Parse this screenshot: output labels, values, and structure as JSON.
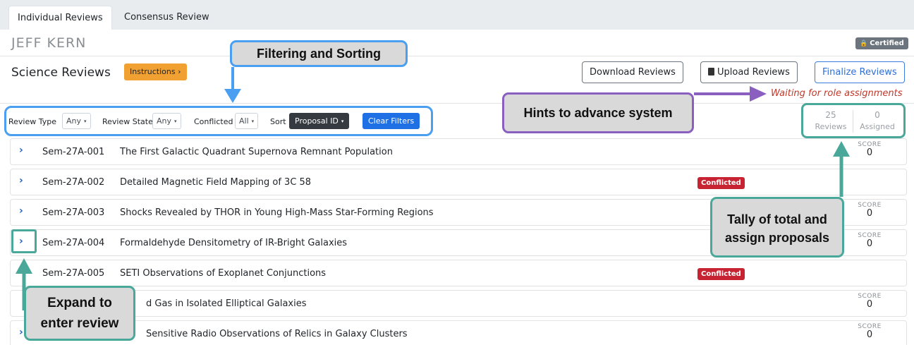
{
  "tabs": [
    {
      "label": "Individual Reviews",
      "active": true
    },
    {
      "label": "Consensus Review",
      "active": false
    }
  ],
  "reviewer": {
    "name": "JEFF KERN",
    "certified_label": "Certified"
  },
  "section": {
    "title": "Science Reviews",
    "instructions_label": "Instructions ›"
  },
  "actions": {
    "download_label": "Download Reviews",
    "upload_label": "Upload Reviews",
    "finalize_label": "Finalize Reviews"
  },
  "status_text": "Waiting for role assignments",
  "filters": {
    "review_type_label": "Review Type",
    "review_type_value": "Any",
    "review_state_label": "Review State",
    "review_state_value": "Any",
    "conflicted_label": "Conflicted",
    "conflicted_value": "All",
    "sort_label": "Sort",
    "sort_value": "Proposal ID",
    "clear_label": "Clear Filters",
    "caret": "▾"
  },
  "tally": {
    "reviews_count": "25",
    "reviews_label": "Reviews",
    "assigned_count": "0",
    "assigned_label": "Assigned"
  },
  "score_label": "SCORE",
  "conflicted_badge": "Conflicted",
  "expand_glyph": "›",
  "proposals": [
    {
      "id": "Sem-27A-001",
      "title": "The First Galactic Quadrant Supernova Remnant Population",
      "score": "0",
      "conflicted": false
    },
    {
      "id": "Sem-27A-002",
      "title": "Detailed Magnetic Field Mapping of 3C 58",
      "score": "",
      "conflicted": true
    },
    {
      "id": "Sem-27A-003",
      "title": "Shocks Revealed by THOR in Young High-Mass Star-Forming Regions",
      "score": "0",
      "conflicted": false
    },
    {
      "id": "Sem-27A-004",
      "title": "Formaldehyde Densitometry of IR-Bright Galaxies",
      "score": "0",
      "conflicted": false
    },
    {
      "id": "Sem-27A-005",
      "title": "SETI Observations of Exoplanet Conjunctions",
      "score": "",
      "conflicted": true
    },
    {
      "id": "",
      "title": "d Gas in Isolated Elliptical Galaxies",
      "score": "0",
      "conflicted": false
    },
    {
      "id": "",
      "title": "Sensitive Radio Observations of Relics in Galaxy Clusters",
      "score": "0",
      "conflicted": false
    }
  ],
  "annotations": {
    "filtering": "Filtering and Sorting",
    "hints": "Hints to advance system",
    "tally_line1": "Tally of total and",
    "tally_line2": "assign proposals",
    "expand_line1": "Expand to",
    "expand_line2": "enter review"
  },
  "colors": {
    "annotation_blue": "#4a9ff0",
    "annotation_purple": "#8a5fc0",
    "annotation_teal": "#4aa89a",
    "conflicted_red": "#c82333",
    "instructions_orange": "#f0a132",
    "clear_filters_blue": "#1f6fe5"
  }
}
